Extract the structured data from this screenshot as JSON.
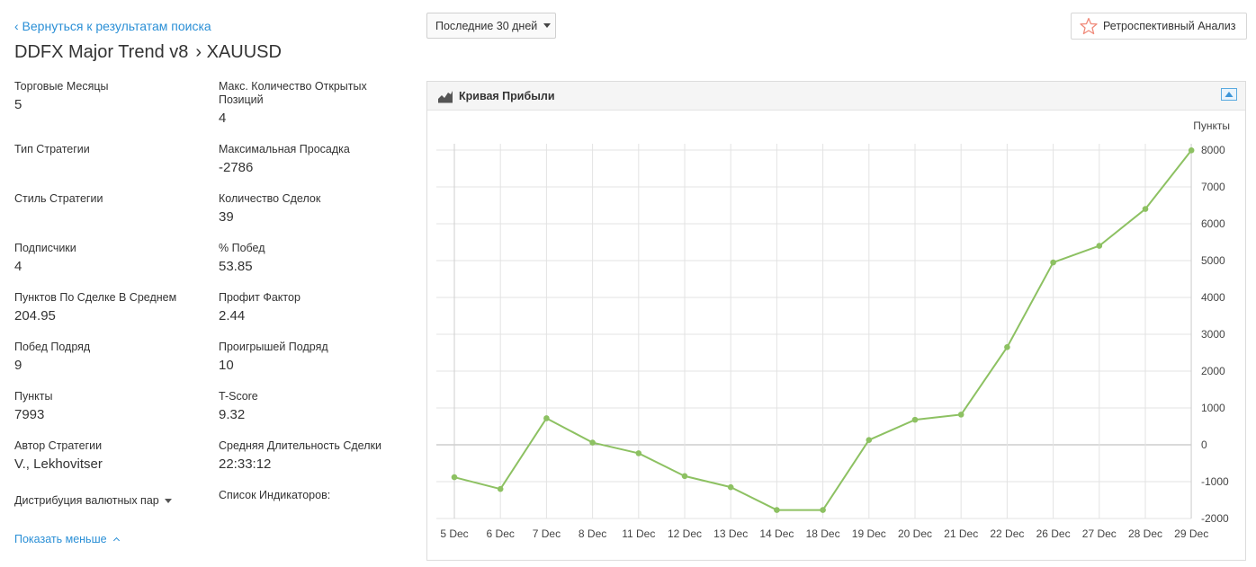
{
  "nav": {
    "back_link": "‹ Вернуться к результатам поиска"
  },
  "title": {
    "strategy": "DDFX Major Trend v8",
    "symbol": "› XAUUSD"
  },
  "stats": {
    "trading_months_label": "Торговые Месяцы",
    "trading_months_value": "5",
    "max_open_positions_label": "Макс. Количество Открытых Позиций",
    "max_open_positions_value": "4",
    "strategy_type_label": "Тип Стратегии",
    "strategy_type_value": "",
    "max_drawdown_label": "Максимальная Просадка",
    "max_drawdown_value": "-2786",
    "strategy_style_label": "Стиль Стратегии",
    "strategy_style_value": "",
    "trade_count_label": "Количество Сделок",
    "trade_count_value": "39",
    "subscribers_label": "Подписчики",
    "subscribers_value": "4",
    "win_pct_label": "% Побед",
    "win_pct_value": "53.85",
    "avg_pips_label": "Пунктов По Сделке В Среднем",
    "avg_pips_value": "204.95",
    "profit_factor_label": "Профит Фактор",
    "profit_factor_value": "2.44",
    "win_streak_label": "Побед Подряд",
    "win_streak_value": "9",
    "loss_streak_label": "Проигрышей Подряд",
    "loss_streak_value": "10",
    "pips_label": "Пункты",
    "pips_value": "7993",
    "tscore_label": "T-Score",
    "tscore_value": "9.32",
    "author_label": "Автор Стратегии",
    "author_value": "V., Lekhovitser",
    "avg_duration_label": "Средняя Длительность Сделки",
    "avg_duration_value": "22:33:12"
  },
  "distribution_label": "Дистрибуция валютных пар",
  "indicators_label": "Список Индикаторов:",
  "show_less_label": "Показать меньше",
  "period_select": {
    "value": "Последние 30 дней"
  },
  "backtest_button": {
    "label": "Ретроспективный Анализ",
    "icon": "star-icon"
  },
  "chart_panel": {
    "title": "Кривая Прибыли",
    "icon": "area-chart-icon",
    "expand_icon": "expand-icon"
  },
  "colors": {
    "accent": "#2a8fd6",
    "line": "#8dc162",
    "star": "#f08a7a"
  },
  "chart_data": {
    "type": "line",
    "title": "",
    "xlabel": "",
    "ylabel": "Пункты",
    "categories": [
      "5 Dec",
      "6 Dec",
      "7 Dec",
      "8 Dec",
      "11 Dec",
      "12 Dec",
      "13 Dec",
      "14 Dec",
      "18 Dec",
      "19 Dec",
      "20 Dec",
      "21 Dec",
      "22 Dec",
      "26 Dec",
      "27 Dec",
      "28 Dec",
      "29 Dec"
    ],
    "values": [
      -880,
      -1200,
      720,
      60,
      -230,
      -850,
      -1150,
      -1770,
      -1770,
      130,
      680,
      820,
      2650,
      4950,
      5400,
      6400,
      7993
    ],
    "ylim": [
      -2000,
      8000
    ],
    "yticks": [
      8000,
      7000,
      6000,
      5000,
      4000,
      3000,
      2000,
      1000,
      0,
      -1000,
      -2000
    ],
    "grid": true,
    "axis_position": "right",
    "line_color": "#8dc162"
  }
}
